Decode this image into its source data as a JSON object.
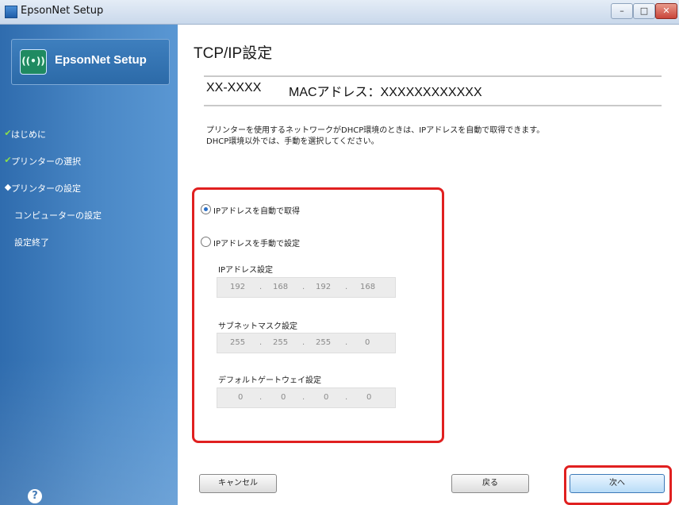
{
  "window": {
    "title": "EpsonNet Setup",
    "controls": {
      "minimize": "–",
      "maximize": "□",
      "close": "✕"
    }
  },
  "sidebar": {
    "brand": {
      "logo_text": "((•))",
      "name": "EpsonNet Setup"
    },
    "steps": [
      {
        "label": "はじめに",
        "state": "done",
        "mark": "✔"
      },
      {
        "label": "プリンターの選択",
        "state": "done",
        "mark": "✔"
      },
      {
        "label": "プリンターの設定",
        "state": "current",
        "mark": "◆"
      },
      {
        "label": "コンピューターの設定",
        "state": "pending",
        "mark": ""
      },
      {
        "label": "設定終了",
        "state": "pending",
        "mark": ""
      }
    ],
    "help_icon": "?"
  },
  "main": {
    "title": "TCP/IP設定",
    "device": {
      "model": "XX-XXXX",
      "mac": "MACアドレス：XXXXXXXXXXXX"
    },
    "description": [
      "プリンターを使用するネットワークがDHCP環境のときは、IPアドレスを自動で取得できます。",
      "DHCP環境以外では、手動を選択してください。"
    ],
    "mode": {
      "auto_label": "IPアドレスを自動で取得",
      "manual_label": "IPアドレスを手動で設定",
      "selected": "auto"
    },
    "fields": {
      "ip": {
        "label": "IPアドレス設定",
        "octets": [
          "192",
          "168",
          "192",
          "168"
        ]
      },
      "subnet": {
        "label": "サブネットマスク設定",
        "octets": [
          "255",
          "255",
          "255",
          "0"
        ]
      },
      "gateway": {
        "label": "デフォルトゲートウェイ設定",
        "octets": [
          "0",
          "0",
          "0",
          "0"
        ]
      },
      "separator": "."
    },
    "buttons": {
      "cancel": "キャンセル",
      "back": "戻る",
      "next": "次へ"
    }
  },
  "colors": {
    "accent_highlight": "#e02020",
    "sidebar": "#3f7ebd",
    "check": "#8be04a"
  }
}
